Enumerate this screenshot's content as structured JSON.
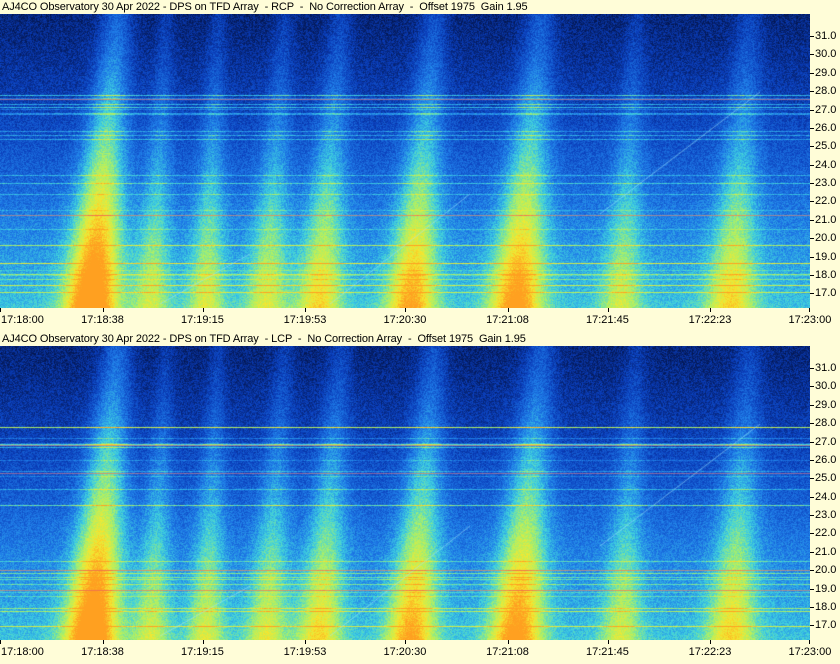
{
  "chart_data": [
    {
      "type": "heatmap",
      "title": "AJ4CO Observatory 30 Apr 2022 - DPS on TFD Array  - RCP  -  No Correction Array  -  Offset 1975  Gain 1.95",
      "ylim": [
        16.2,
        32.2
      ],
      "y_ticks": [
        "17.0",
        "18.0",
        "19.0",
        "20.0",
        "21.0",
        "22.0",
        "23.0",
        "24.0",
        "25.0",
        "26.0",
        "27.0",
        "28.0",
        "29.0",
        "30.0",
        "31.0"
      ],
      "x_ticks": [
        "17:18:00",
        "17:18:38",
        "17:19:15",
        "17:19:53",
        "17:20:30",
        "17:21:08",
        "17:21:45",
        "17:22:23",
        "17:23:00"
      ],
      "x_range": [
        "17:18:00",
        "17:23:00"
      ],
      "colormap": [
        "#03103f",
        "#0a3dba",
        "#1f7ce8",
        "#3ed0e0",
        "#a8f06a",
        "#f4e830",
        "#ffa020"
      ]
    },
    {
      "type": "heatmap",
      "title": "AJ4CO Observatory 30 Apr 2022 - DPS on TFD Array  - LCP  -  No Correction Array  -  Offset 1975  Gain 1.95",
      "ylim": [
        16.2,
        32.2
      ],
      "y_ticks": [
        "17.0",
        "18.0",
        "19.0",
        "20.0",
        "21.0",
        "22.0",
        "23.0",
        "24.0",
        "25.0",
        "26.0",
        "27.0",
        "28.0",
        "29.0",
        "30.0",
        "31.0"
      ],
      "x_ticks": [
        "17:18:00",
        "17:18:38",
        "17:19:15",
        "17:19:53",
        "17:20:30",
        "17:21:08",
        "17:21:45",
        "17:22:23",
        "17:23:00"
      ],
      "x_range": [
        "17:18:00",
        "17:23:00"
      ],
      "colormap": [
        "#03103f",
        "#0a3dba",
        "#1f7ce8",
        "#3ed0e0",
        "#a8f06a",
        "#f4e830",
        "#ffa020"
      ]
    }
  ]
}
